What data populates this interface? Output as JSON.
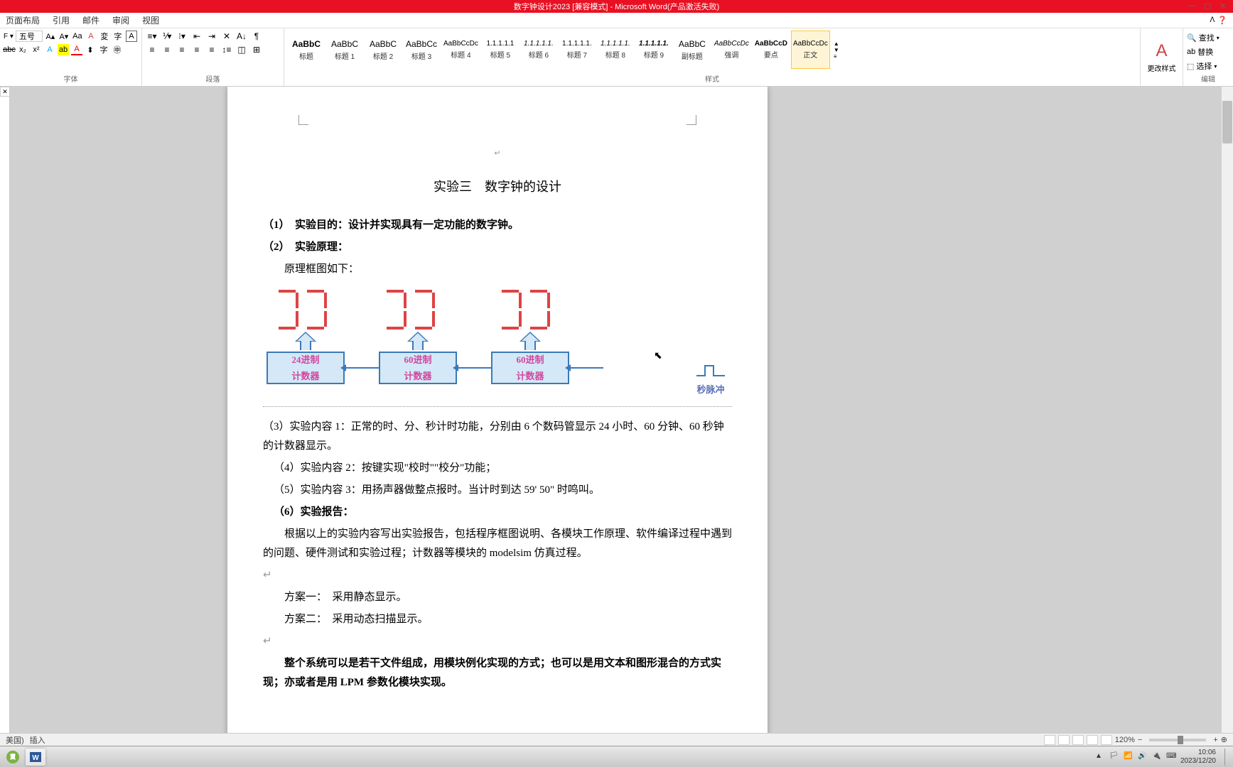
{
  "titleBar": {
    "text": "数字钟设计2023 [兼容模式] - Microsoft Word(产品激活失败)"
  },
  "menuBar": {
    "items": [
      "页面布局",
      "引用",
      "邮件",
      "审阅",
      "视图"
    ]
  },
  "ribbon": {
    "fontGroup": {
      "label": "字体",
      "fontSize": "五号"
    },
    "paragraphGroup": {
      "label": "段落"
    },
    "stylesGroup": {
      "label": "样式",
      "styles": [
        {
          "preview": "AaBbC",
          "name": "标题"
        },
        {
          "preview": "AaBbC",
          "name": "标题 1"
        },
        {
          "preview": "AaBbC",
          "name": "标题 2"
        },
        {
          "preview": "AaBbCc",
          "name": "标题 3"
        },
        {
          "preview": "AaBbCcDc",
          "name": "标题 4"
        },
        {
          "preview": "1.1.1.1.1",
          "name": "标题 5"
        },
        {
          "preview": "1.1.1.1.1.",
          "name": "标题 6"
        },
        {
          "preview": "1.1.1.1.1.",
          "name": "标题 7"
        },
        {
          "preview": "1.1.1.1.1.",
          "name": "标题 8"
        },
        {
          "preview": "1.1.1.1.1.",
          "name": "标题 9"
        },
        {
          "preview": "AaBbC",
          "name": "副标题"
        },
        {
          "preview": "AaBbCcDc",
          "name": "强调"
        },
        {
          "preview": "AaBbCcD",
          "name": "要点"
        },
        {
          "preview": "AaBbCcDc",
          "name": "正文"
        }
      ],
      "changeStyles": "更改样式"
    },
    "editGroup": {
      "label": "编辑",
      "find": "查找",
      "replace": "替换",
      "select": "选择"
    }
  },
  "document": {
    "title": "实验三　数字钟的设计",
    "line1": "（1）　实验目的：设计并实现具有一定功能的数字钟。",
    "line2": "（2）　实验原理：",
    "line3": "原理框图如下：",
    "counter1_line1": "24进制",
    "counter1_line2": "计数器",
    "counter2_line1": "60进制",
    "counter2_line2": "计数器",
    "counter3_line1": "60进制",
    "counter3_line2": "计数器",
    "pulseLabel": "秒脉冲",
    "line4": "（3）实验内容 1：正常的时、分、秒计时功能，分别由 6 个数码管显示 24 小时、60 分钟、60 秒钟的计数器显示。",
    "line5": "（4）实验内容 2：按键实现\"校时\"\"校分\"功能；",
    "line6": "（5）实验内容 3：用扬声器做整点报时。当计时到达 59' 50\" 时鸣叫。",
    "line7": "（6）实验报告：",
    "line8": "根据以上的实验内容写出实验报告，包括程序框图说明、各模块工作原理、软件编译过程中遇到的问题、硬件测试和实验过程；计数器等模块的 modelsim 仿真过程。",
    "line9": "方案一：　采用静态显示。",
    "line10": "方案二：　采用动态扫描显示。",
    "line11": "整个系统可以是若干文件组成，用模块例化实现的方式；也可以是用文本和图形混合的方式实现；亦或者是用 LPM 参数化模块实现。"
  },
  "statusBar": {
    "lang": "美国)",
    "mode": "插入",
    "zoom": "120%"
  },
  "taskbar": {
    "time": "10:06",
    "date": "2023/12/20"
  }
}
